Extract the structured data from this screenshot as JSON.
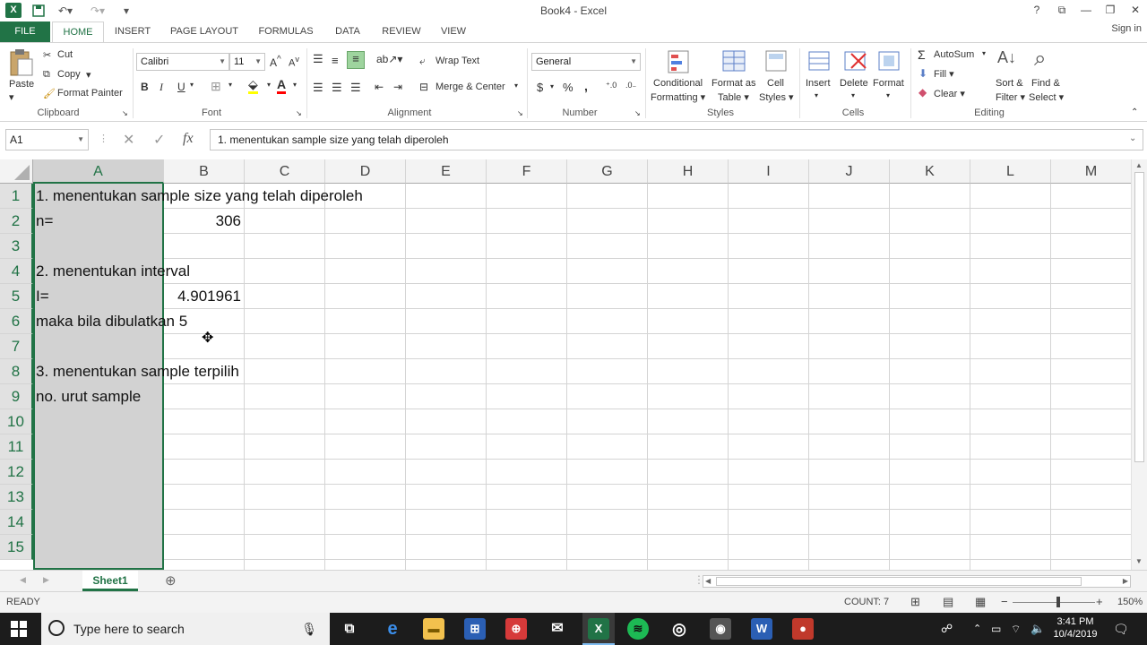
{
  "window": {
    "title": "Book4 - Excel",
    "help": "?",
    "restore_ribbon": "⧉",
    "minimize": "—",
    "maximize": "❐",
    "close": "✕"
  },
  "quick_access": {
    "save_icon": "save-icon",
    "undo_icon": "undo-icon",
    "redo_icon": "redo-icon"
  },
  "ribbon_tabs": [
    "FILE",
    "HOME",
    "INSERT",
    "PAGE LAYOUT",
    "FORMULAS",
    "DATA",
    "REVIEW",
    "VIEW"
  ],
  "sign_in": "Sign in",
  "clipboard": {
    "paste": "Paste",
    "cut": "Cut",
    "copy": "Copy",
    "format_painter": "Format Painter",
    "group": "Clipboard"
  },
  "font": {
    "name": "Calibri",
    "size": "11",
    "bold": "B",
    "italic": "I",
    "underline": "U",
    "group": "Font"
  },
  "alignment": {
    "wrap": "Wrap Text",
    "merge": "Merge & Center",
    "group": "Alignment"
  },
  "number": {
    "format": "General",
    "currency": "$",
    "percent": "%",
    "comma": ",",
    "group": "Number"
  },
  "styles": {
    "conditional1": "Conditional",
    "conditional2": "Formatting",
    "format_as1": "Format as",
    "format_as2": "Table",
    "cell1": "Cell",
    "cell2": "Styles",
    "group": "Styles"
  },
  "cells": {
    "insert": "Insert",
    "delete": "Delete",
    "format": "Format",
    "group": "Cells"
  },
  "editing": {
    "autosum": "AutoSum",
    "fill": "Fill",
    "clear": "Clear",
    "sort1": "Sort &",
    "sort2": "Filter",
    "find1": "Find &",
    "find2": "Select",
    "group": "Editing"
  },
  "formula_bar": {
    "name_box": "A1",
    "cancel": "✕",
    "enter": "✓",
    "fx": "fx",
    "content": "1. menentukan sample size yang telah diperoleh"
  },
  "columns": [
    "A",
    "B",
    "C",
    "D",
    "E",
    "F",
    "G",
    "H",
    "I",
    "J",
    "K",
    "L",
    "M"
  ],
  "rows": [
    "1",
    "2",
    "3",
    "4",
    "5",
    "6",
    "7",
    "8",
    "9",
    "10",
    "11",
    "12",
    "13",
    "14",
    "15"
  ],
  "cells_data": {
    "A1": "1. menentukan sample size yang telah diperoleh",
    "A2": "n=",
    "B2": "306",
    "A4": "2. menentukan interval",
    "A5": "I=",
    "B5": "4.901961",
    "A6": "maka bila dibulatkan 5",
    "A8": "3. menentukan sample terpilih",
    "A9": "no. urut sample"
  },
  "sheet": {
    "name": "Sheet1",
    "add": "⊕"
  },
  "status": {
    "mode": "READY",
    "count": "COUNT: 7",
    "zoom": "150%"
  },
  "taskbar": {
    "search_placeholder": "Type here to search",
    "time": "3:41 PM",
    "date": "10/4/2019"
  }
}
